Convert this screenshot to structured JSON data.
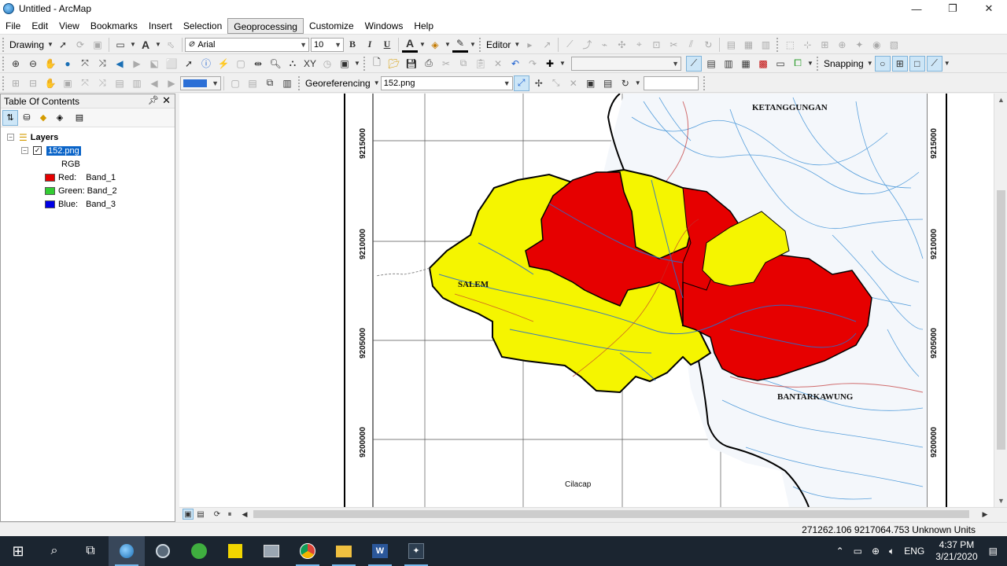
{
  "window": {
    "title": "Untitled - ArcMap",
    "minimize": "—",
    "maximize": "❐",
    "close": "✕"
  },
  "menu": [
    "File",
    "Edit",
    "View",
    "Bookmarks",
    "Insert",
    "Selection",
    "Geoprocessing",
    "Customize",
    "Windows",
    "Help"
  ],
  "toolbar1": {
    "drawing_label": "Drawing",
    "font_name": "Arial",
    "font_size": "10",
    "bold": "B",
    "italic": "I",
    "underline": "U",
    "font_color_letter": "A",
    "editor_label": "Editor"
  },
  "toolbar2": {
    "snapping_label": "Snapping"
  },
  "toolbar3": {
    "georef_label": "Georeferencing",
    "georef_layer": "152.png"
  },
  "toc": {
    "title": "Table Of Contents",
    "root": "Layers",
    "layer": "152.png",
    "renderer": "RGB",
    "bands": [
      {
        "channel": "Red:",
        "band": "Band_1",
        "color": "#e60000"
      },
      {
        "channel": "Green:",
        "band": "Band_2",
        "color": "#33cc33"
      },
      {
        "channel": "Blue:",
        "band": "Band_3",
        "color": "#0000e6"
      }
    ]
  },
  "map": {
    "labels": {
      "ketanggungan": "KETANGGUNGAN",
      "salem": "SALEM",
      "bantarkawung": "BANTARKAWUNG",
      "cilacap": "Cilacap"
    },
    "grid_labels_left": [
      "9215000",
      "9210000",
      "9205000",
      "9200000"
    ],
    "grid_labels_right": [
      "9215000",
      "9210000",
      "9205000",
      "9200000"
    ],
    "colors": {
      "red_zone": "#e60000",
      "yellow_zone": "#f5f500",
      "river": "#3a8fd6",
      "border": "#000000"
    }
  },
  "status": {
    "coords": "271262.106  9217064.753 Unknown Units"
  },
  "taskbar": {
    "lang": "ENG",
    "time": "4:37 PM",
    "date": "3/21/2020"
  }
}
